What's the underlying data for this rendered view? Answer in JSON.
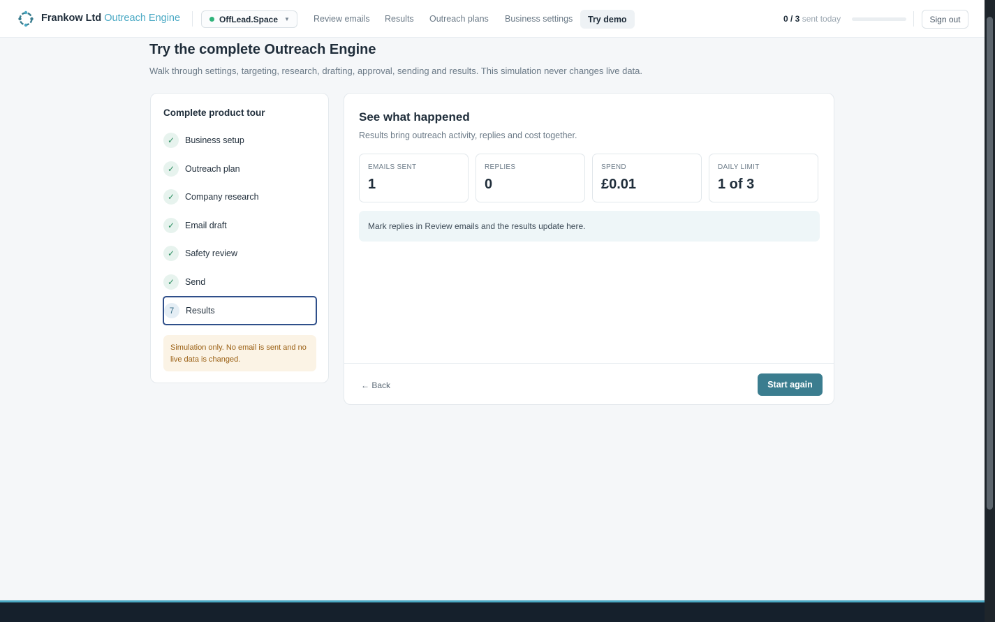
{
  "header": {
    "brand_name": "Frankow Ltd",
    "brand_product": "Outreach Engine",
    "workspace": "OffLead.Space",
    "nav": [
      {
        "label": "Review emails"
      },
      {
        "label": "Results"
      },
      {
        "label": "Outreach plans"
      },
      {
        "label": "Business settings"
      },
      {
        "label": "Try demo"
      }
    ],
    "sent_count": "0 / 3",
    "sent_suffix": "sent today",
    "sent_fraction": 0,
    "sign_out": "Sign out"
  },
  "page": {
    "title": "Try the complete Outreach Engine",
    "subtitle": "Walk through settings, targeting, research, drafting, approval, sending and results. This simulation never changes live data."
  },
  "tour": {
    "title": "Complete product tour",
    "steps": [
      {
        "badge": "✓",
        "label": "Business setup"
      },
      {
        "badge": "✓",
        "label": "Outreach plan"
      },
      {
        "badge": "✓",
        "label": "Company research"
      },
      {
        "badge": "✓",
        "label": "Email draft"
      },
      {
        "badge": "✓",
        "label": "Safety review"
      },
      {
        "badge": "✓",
        "label": "Send"
      },
      {
        "badge": "7",
        "label": "Results"
      }
    ],
    "notice": "Simulation only. No email is sent and no live data is changed."
  },
  "results": {
    "title": "See what happened",
    "subtitle": "Results bring outreach activity, replies and cost together.",
    "stats": [
      {
        "label": "EMAILS SENT",
        "value": "1"
      },
      {
        "label": "REPLIES",
        "value": "0"
      },
      {
        "label": "SPEND",
        "value": "£0.01"
      },
      {
        "label": "DAILY LIMIT",
        "value": "1 of 3"
      }
    ],
    "info": "Mark replies in Review emails and the results update here.",
    "back_label": "← Back",
    "start_again_label": "Start again"
  },
  "colors": {
    "accent": "#4aa9c4",
    "primary_button": "#3b7d8f",
    "success": "#2a8d5f",
    "warning_text": "#9a5f12"
  }
}
